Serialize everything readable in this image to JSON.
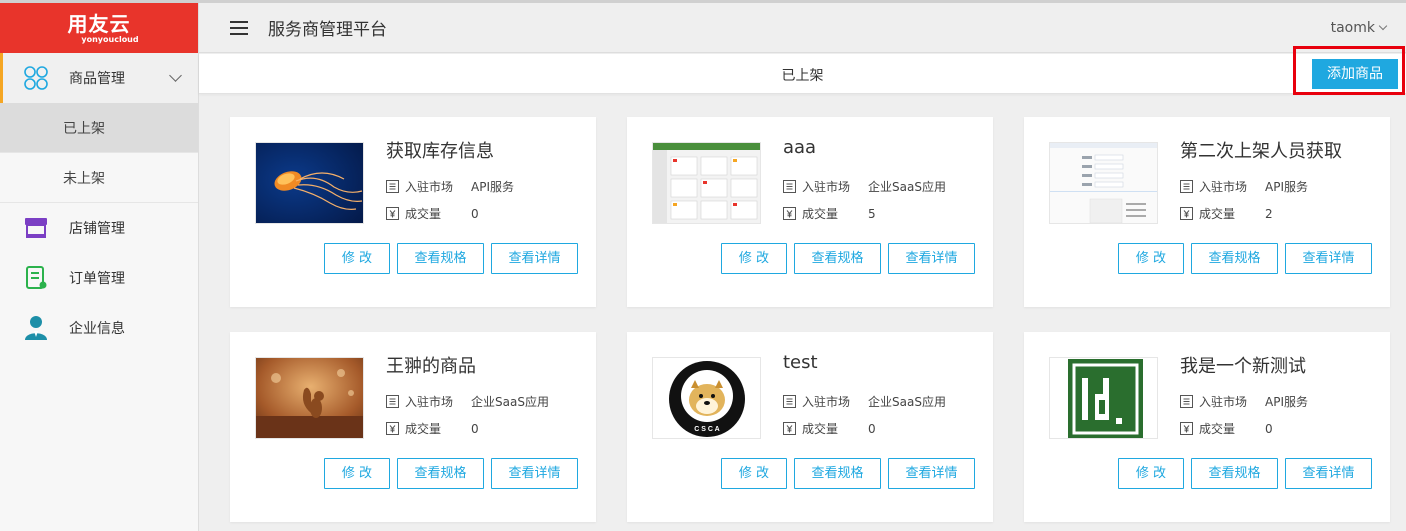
{
  "logo": {
    "main": "用友云",
    "sub": "yonyoucloud"
  },
  "header": {
    "title": "服务商管理平台",
    "user": "taomk"
  },
  "sidebar": {
    "items": [
      {
        "label": "商品管理",
        "icon": "grid-icon",
        "subitems": [
          {
            "label": "已上架"
          },
          {
            "label": "未上架"
          }
        ]
      },
      {
        "label": "店铺管理",
        "icon": "store-icon"
      },
      {
        "label": "订单管理",
        "icon": "order-icon"
      },
      {
        "label": "企业信息",
        "icon": "person-icon"
      }
    ]
  },
  "subheader": {
    "title": "已上架",
    "add_label": "添加商品"
  },
  "labels": {
    "market": "入驻市场",
    "deals": "成交量",
    "edit": "修 改",
    "specs": "查看规格",
    "details": "查看详情"
  },
  "products": [
    {
      "name": "获取库存信息",
      "market": "API服务",
      "deals": "0",
      "image": "jellyfish"
    },
    {
      "name": "aaa",
      "market": "企业SaaS应用",
      "deals": "5",
      "image": "screenshot-dashboard"
    },
    {
      "name": "第二次上架人员获取",
      "market": "API服务",
      "deals": "2",
      "image": "screenshot-form"
    },
    {
      "name": "王翀的商品",
      "market": "企业SaaS应用",
      "deals": "0",
      "image": "squirrel"
    },
    {
      "name": "test",
      "market": "企业SaaS应用",
      "deals": "0",
      "image": "doge-badge"
    },
    {
      "name": "我是一个新测试",
      "market": "API服务",
      "deals": "0",
      "image": "id-logo"
    }
  ],
  "colors": {
    "brand_red": "#e8342b",
    "accent_blue": "#1fa8e0",
    "active_bar": "#f5a623"
  }
}
